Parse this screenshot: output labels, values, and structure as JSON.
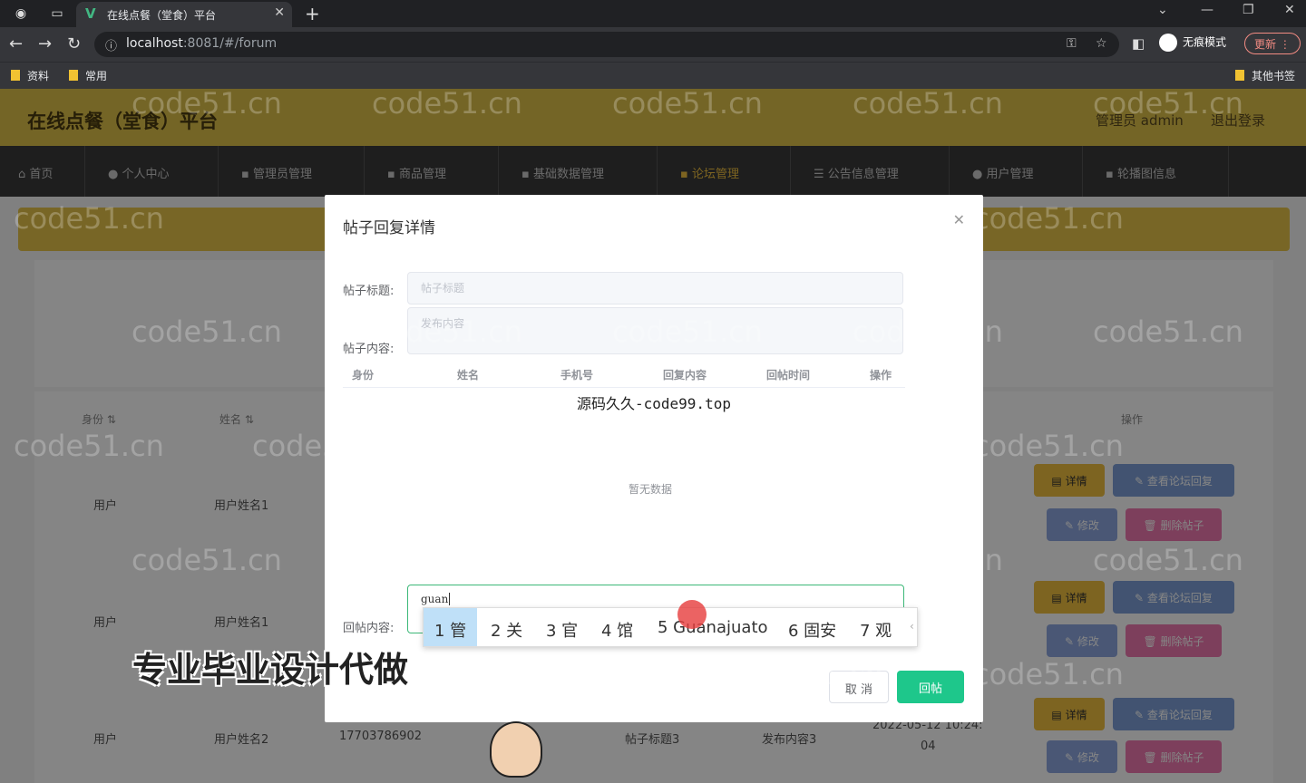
{
  "browser": {
    "tab_title": "在线点餐（堂食）平台",
    "url_host": "localhost",
    "url_rest": ":8081/#/forum",
    "incognito_label": "无痕模式",
    "update_label": "更新",
    "bookmarks": [
      "资料",
      "常用"
    ],
    "other_bookmarks": "其他书签"
  },
  "header": {
    "title": "在线点餐（堂食）平台",
    "admin": "管理员 admin",
    "logout": "退出登录"
  },
  "menu": [
    "首页",
    "个人中心",
    "管理员管理",
    "商品管理",
    "基础数据管理",
    "论坛管理",
    "公告信息管理",
    "用户管理",
    "轮播图信息"
  ],
  "menu_active": "论坛管理",
  "table": {
    "headers": [
      "身份",
      "姓名",
      "操作"
    ],
    "rows": [
      {
        "role": "用户",
        "name": "用户姓名1"
      },
      {
        "role": "用户",
        "name": "用户姓名1"
      },
      {
        "role": "用户",
        "name": "用户姓名2",
        "phone": "17703786902",
        "post_title": "帖子标题3",
        "post_content": "发布内容3",
        "time_line1": "2022-05-12 10:24:",
        "time_line2": "04"
      }
    ],
    "actions": {
      "detail": "详情",
      "view_replies": "查看论坛回复",
      "edit": "修改",
      "delete": "删除帖子"
    }
  },
  "dialog": {
    "title": "帖子回复详情",
    "post_title_label": "帖子标题:",
    "post_title_placeholder": "帖子标题",
    "post_content_label": "帖子内容:",
    "post_content_placeholder": "发布内容",
    "columns": [
      "身份",
      "姓名",
      "手机号",
      "回复内容",
      "回帖时间",
      "操作"
    ],
    "empty": "暂无数据",
    "reply_label": "回帖内容:",
    "reply_value": "guan",
    "cancel": "取 消",
    "submit": "回帖"
  },
  "ime_candidates": [
    "1 管",
    "2 关",
    "3 官",
    "4 馆",
    "5 Guanajuato",
    "6 固安",
    "7 观"
  ],
  "watermark": "code51.cn",
  "caption": "源码久久-code99.top",
  "promo": "专业毕业设计代做"
}
